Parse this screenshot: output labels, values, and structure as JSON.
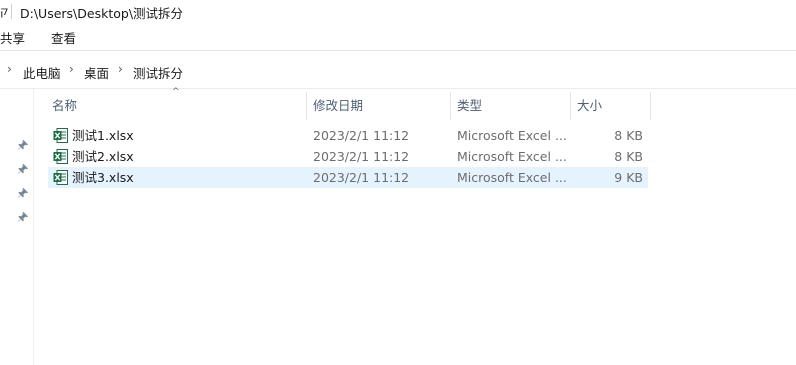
{
  "titlebar": {
    "edge_glyph": "ק",
    "path": "D:\\Users\\Desktop\\测试拆分"
  },
  "ribbon": {
    "tabs": [
      "共享",
      "查看"
    ]
  },
  "address": {
    "crumbs": [
      "此电脑",
      "桌面",
      "测试拆分"
    ]
  },
  "columns": {
    "name": "名称",
    "date": "修改日期",
    "type": "类型",
    "size": "大小"
  },
  "files": [
    {
      "name": "测试1.xlsx",
      "date": "2023/2/1 11:12",
      "type": "Microsoft Excel ...",
      "size": "8 KB",
      "selected": false
    },
    {
      "name": "测试2.xlsx",
      "date": "2023/2/1 11:12",
      "type": "Microsoft Excel ...",
      "size": "8 KB",
      "selected": false
    },
    {
      "name": "测试3.xlsx",
      "date": "2023/2/1 11:12",
      "type": "Microsoft Excel ...",
      "size": "9 KB",
      "selected": true
    }
  ],
  "colors": {
    "selection": "#e5f3ff",
    "excel_green": "#1d7044",
    "header_text": "#4c607a"
  },
  "icons": {
    "file_icon": "excel-file-icon",
    "pin_icon": "pin-icon",
    "sort_icon": "sort-ascending-icon",
    "crumb_separator": "chevron-right-icon"
  }
}
